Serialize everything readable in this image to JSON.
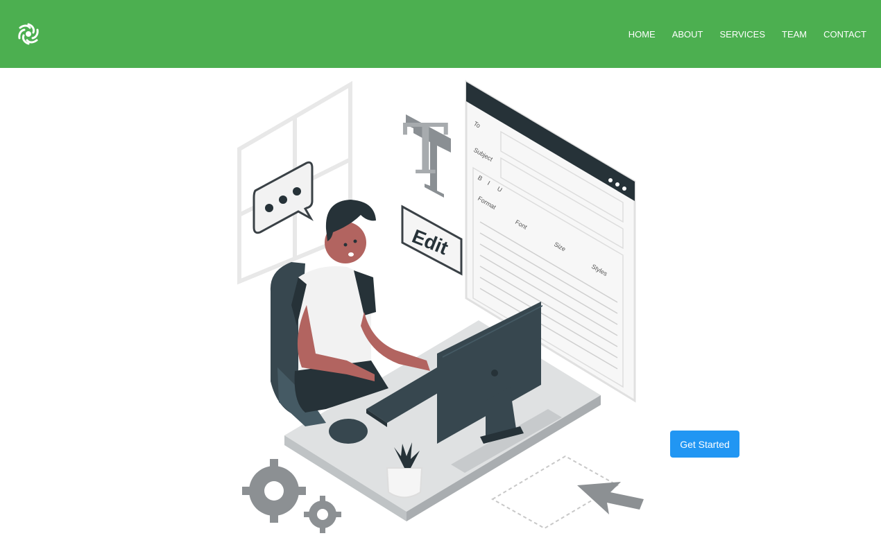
{
  "header": {
    "logo_icon": "swirl-flower-icon",
    "background_color": "#4caf50",
    "nav": [
      {
        "label": "HOME"
      },
      {
        "label": "ABOUT"
      },
      {
        "label": "SERVICES"
      },
      {
        "label": "TEAM"
      },
      {
        "label": "CONTACT"
      }
    ]
  },
  "hero": {
    "illustration_icon": "person-editing-document-illustration",
    "editor": {
      "to_label": "To",
      "subject_label": "Subject",
      "format_label": "Format",
      "font_label": "Font",
      "size_label": "Size",
      "styles_label": "Styles",
      "toolbar_b": "B",
      "toolbar_i": "I",
      "toolbar_u": "U"
    },
    "edit_sign": "Edit",
    "letter": "T",
    "cta_label": "Get Started",
    "cta_color": "#2196f3"
  }
}
